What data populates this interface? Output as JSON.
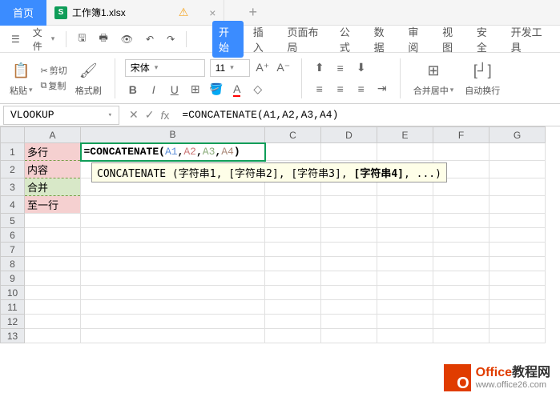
{
  "titlebar": {
    "home_label": "首页",
    "file_icon": "S",
    "file_name": "工作簿1.xlsx"
  },
  "menubar": {
    "file_label": "文件",
    "tabs": {
      "start": "开始",
      "insert": "插入",
      "layout": "页面布局",
      "formula": "公式",
      "data": "数据",
      "review": "审阅",
      "view": "视图",
      "security": "安全",
      "dev": "开发工具"
    }
  },
  "toolbar": {
    "paste_label": "粘贴",
    "cut_label": "剪切",
    "copy_label": "复制",
    "format_painter": "格式刷",
    "font_name": "宋体",
    "font_size": "11",
    "merge_label": "合并居中",
    "wrap_label": "自动换行"
  },
  "formula_bar": {
    "name_box": "VLOOKUP",
    "formula": "=CONCATENATE(A1,A2,A3,A4)"
  },
  "cells": {
    "a1": "多行",
    "a2": "内容",
    "a3": "合并",
    "a4": "至一行",
    "b1_func": "=CONCATENATE",
    "b1_a1": "A1",
    "b1_a2": "A2",
    "b1_a3": "A3",
    "b1_a4": "A4"
  },
  "tooltip": {
    "fn": "CONCATENATE",
    "args": " (字符串1, [字符串2], [字符串3], ",
    "bold_arg": "[字符串4]",
    "rest": ", ...)"
  },
  "columns": [
    "A",
    "B",
    "C",
    "D",
    "E",
    "F",
    "G"
  ],
  "rows": [
    "1",
    "2",
    "3",
    "4",
    "5",
    "6",
    "7",
    "8",
    "9",
    "10",
    "11",
    "12",
    "13"
  ],
  "watermark": {
    "title_a": "Office",
    "title_b": "教程网",
    "url": "www.office26.com"
  }
}
